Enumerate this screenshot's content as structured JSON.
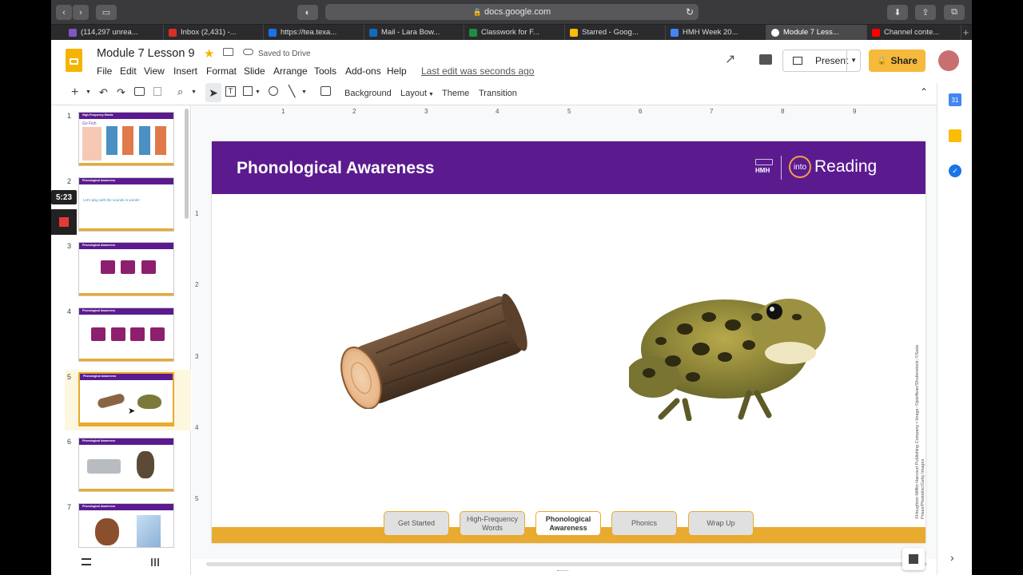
{
  "browser": {
    "url": "docs.google.com",
    "tabs": [
      {
        "label": "(114,297 unrea...",
        "color": "#7e57c2"
      },
      {
        "label": "Inbox (2,431) -...",
        "color": "#d93025"
      },
      {
        "label": "https://tea.texa...",
        "color": "#1a73e8"
      },
      {
        "label": "Mail - Lara Bow...",
        "color": "#0f6cbd"
      },
      {
        "label": "Classwork for F...",
        "color": "#1e8e3e"
      },
      {
        "label": "Starred - Goog...",
        "color": "#fbbc04"
      },
      {
        "label": "HMH Week 20...",
        "color": "#4285f4"
      },
      {
        "label": "Module 7 Less...",
        "color": "#ffffff"
      },
      {
        "label": "Channel conte...",
        "color": "#ff0000"
      }
    ]
  },
  "doc": {
    "title": "Module 7 Lesson 9",
    "saved": "Saved to Drive",
    "last_edit": "Last edit was seconds ago",
    "present_label": "Present",
    "share_label": "Share",
    "menu": [
      "File",
      "Edit",
      "View",
      "Insert",
      "Format",
      "Slide",
      "Arrange",
      "Tools",
      "Add-ons",
      "Help"
    ]
  },
  "toolbar": {
    "background": "Background",
    "layout": "Layout",
    "theme": "Theme",
    "transition": "Transition"
  },
  "recorder": {
    "time": "5:23"
  },
  "thumbnails": [
    {
      "num": "1",
      "title": "High-Frequency Words",
      "subtitle": "Go Fish"
    },
    {
      "num": "2",
      "title": "Phonological Awareness",
      "subtitle": "Let's play with the sounds in words!"
    },
    {
      "num": "3",
      "title": "Phonological Awareness"
    },
    {
      "num": "4",
      "title": "Phonological Awareness"
    },
    {
      "num": "5",
      "title": "Phonological Awareness"
    },
    {
      "num": "6",
      "title": "Phonological Awareness"
    },
    {
      "num": "7",
      "title": "Phonological Awareness"
    }
  ],
  "ruler": {
    "h": [
      "1",
      "2",
      "3",
      "4",
      "5",
      "6",
      "7",
      "8",
      "9"
    ],
    "v": [
      "1",
      "2",
      "3",
      "4",
      "5"
    ]
  },
  "slide": {
    "title": "Phonological Awareness",
    "brand_hmh": "HMH",
    "brand_into": "into",
    "brand_reading": "Reading",
    "copyright": "©Houghton Mifflin Harcourt Publishing Company • Image: ©jsteffean/Shutterstock; ©Sede Prises/Photodisc/Getty Images",
    "nav": [
      "Get Started",
      "High-Frequency Words",
      "Phonological Awareness",
      "Phonics",
      "Wrap Up"
    ],
    "active_nav": "Phonological Awareness",
    "pictures": [
      "log",
      "frog"
    ]
  },
  "colors": {
    "brand_purple": "#5b1b8f",
    "brand_gold": "#e8aa2f",
    "share_yellow": "#f6b93b"
  }
}
